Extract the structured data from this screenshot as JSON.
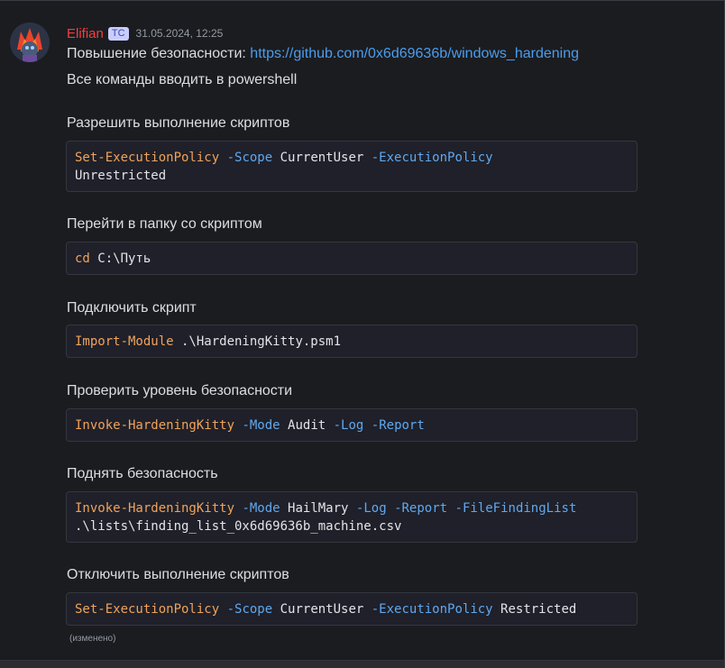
{
  "message": {
    "author": "Elifian",
    "tag": "TC",
    "timestamp": "31.05.2024, 12:25",
    "intro_label": "Повышение безопасности: ",
    "link": "https://github.com/0x6d69636b/windows_hardening",
    "line2": "Все команды вводить в powershell",
    "edited_label": "(изменено)",
    "colors": {
      "author": "#f23f43",
      "link": "#4a9ded",
      "command": "#f0a35a",
      "parameter": "#5fa8f0"
    }
  },
  "steps": [
    {
      "heading": "Разрешить выполнение скриптов",
      "code": [
        {
          "t": "cmd",
          "v": "Set-ExecutionPolicy"
        },
        {
          "t": "plain",
          "v": " "
        },
        {
          "t": "param",
          "v": "-Scope"
        },
        {
          "t": "plain",
          "v": " CurrentUser "
        },
        {
          "t": "param",
          "v": "-ExecutionPolicy"
        },
        {
          "t": "plain",
          "v": "\nUnrestricted"
        }
      ]
    },
    {
      "heading": "Перейти в папку со скриптом",
      "code": [
        {
          "t": "cmd",
          "v": "cd"
        },
        {
          "t": "plain",
          "v": " C:\\Путь"
        }
      ]
    },
    {
      "heading": "Подключить скрипт",
      "code": [
        {
          "t": "cmd",
          "v": "Import-Module"
        },
        {
          "t": "plain",
          "v": " .\\HardeningKitty.psm1"
        }
      ]
    },
    {
      "heading": "Проверить уровень безопасности",
      "code": [
        {
          "t": "cmd",
          "v": "Invoke-HardeningKitty"
        },
        {
          "t": "plain",
          "v": " "
        },
        {
          "t": "param",
          "v": "-Mode"
        },
        {
          "t": "plain",
          "v": " Audit "
        },
        {
          "t": "param",
          "v": "-Log"
        },
        {
          "t": "plain",
          "v": " "
        },
        {
          "t": "param",
          "v": "-Report"
        }
      ]
    },
    {
      "heading": "Поднять безопасность",
      "code": [
        {
          "t": "cmd",
          "v": "Invoke-HardeningKitty"
        },
        {
          "t": "plain",
          "v": " "
        },
        {
          "t": "param",
          "v": "-Mode"
        },
        {
          "t": "plain",
          "v": " HailMary "
        },
        {
          "t": "param",
          "v": "-Log"
        },
        {
          "t": "plain",
          "v": " "
        },
        {
          "t": "param",
          "v": "-Report"
        },
        {
          "t": "plain",
          "v": " "
        },
        {
          "t": "param",
          "v": "-FileFindingList"
        },
        {
          "t": "plain",
          "v": "\n.\\lists\\finding_list_0x6d69636b_machine.csv"
        }
      ]
    },
    {
      "heading": "Отключить выполнение скриптов",
      "code": [
        {
          "t": "cmd",
          "v": "Set-ExecutionPolicy"
        },
        {
          "t": "plain",
          "v": " "
        },
        {
          "t": "param",
          "v": "-Scope"
        },
        {
          "t": "plain",
          "v": " CurrentUser "
        },
        {
          "t": "param",
          "v": "-ExecutionPolicy"
        },
        {
          "t": "plain",
          "v": " Restricted"
        }
      ]
    }
  ]
}
